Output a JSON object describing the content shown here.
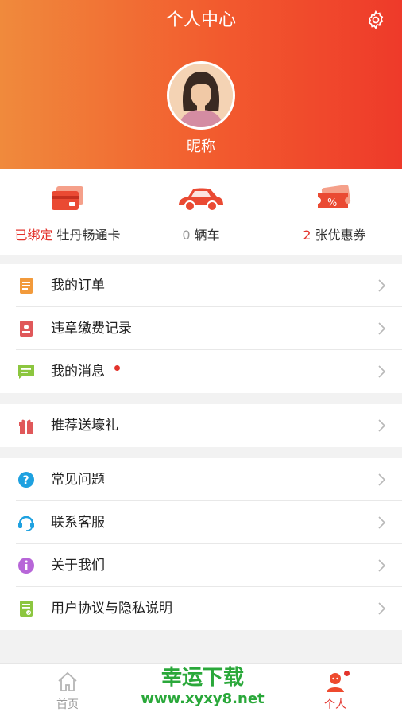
{
  "header": {
    "title": "个人中心",
    "nickname": "昵称"
  },
  "stats": {
    "card": {
      "status": "已绑定",
      "label": "牡丹畅通卡"
    },
    "cars": {
      "count": "0",
      "label": "辆车"
    },
    "coupons": {
      "count": "2",
      "label": "张优惠券"
    }
  },
  "menu": {
    "orders": "我的订单",
    "violations": "违章缴费记录",
    "messages": "我的消息",
    "referral": "推荐送壕礼",
    "faq": "常见问题",
    "support": "联系客服",
    "about": "关于我们",
    "agreement": "用户协议与隐私说明"
  },
  "tabbar": {
    "home": "首页",
    "profile": "个人"
  },
  "watermark": {
    "line1": "幸运下载",
    "line2": "www.xyxy8.net"
  },
  "colors": {
    "accent": "#e3332c",
    "header_start": "#f08a3c",
    "header_end": "#ee3a2a"
  }
}
